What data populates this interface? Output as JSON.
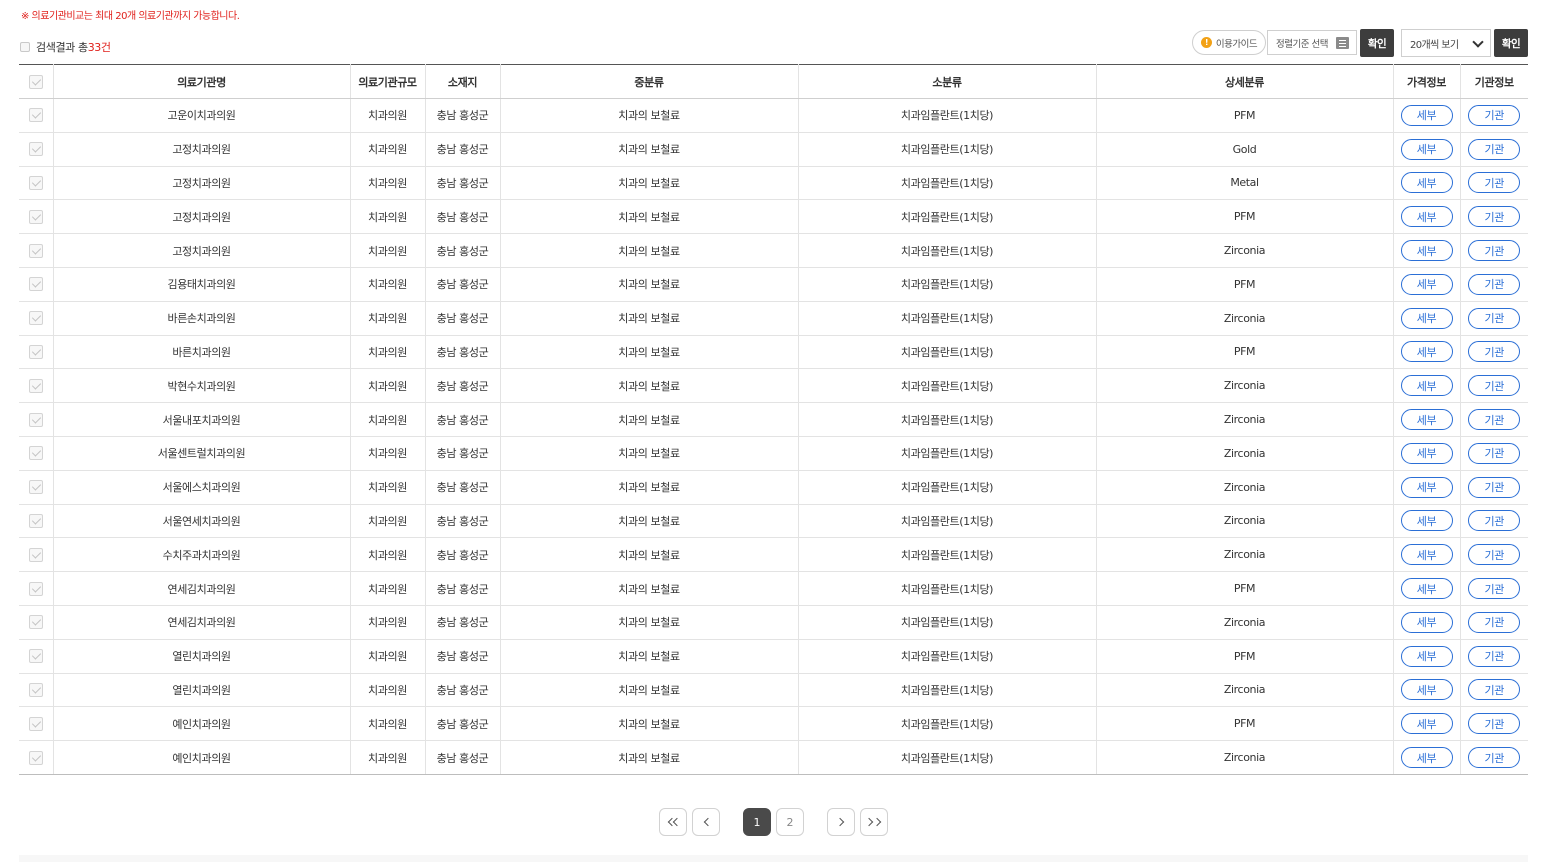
{
  "notice": "※ 의료기관비교는 최대 20개 의료기관까지 가능합니다.",
  "result": {
    "prefix": "검색결과 총",
    "count": "33건"
  },
  "toolbar": {
    "guide_label": "이용가이드",
    "sort_placeholder": "정렬기준 선택",
    "confirm_label": "확인",
    "view_label": "20개씩 보기",
    "confirm2_label": "확인"
  },
  "table": {
    "headers": [
      "의료기관명",
      "의료기관규모",
      "소재지",
      "중분류",
      "소분류",
      "상세분류",
      "가격정보",
      "기관정보"
    ],
    "price_button": "세부",
    "org_button": "기관",
    "rows": [
      [
        "고운이치과의원",
        "치과의원",
        "충남 홍성군",
        "치과의 보철료",
        "치과임플란트(1치당)",
        "PFM"
      ],
      [
        "고정치과의원",
        "치과의원",
        "충남 홍성군",
        "치과의 보철료",
        "치과임플란트(1치당)",
        "Gold"
      ],
      [
        "고정치과의원",
        "치과의원",
        "충남 홍성군",
        "치과의 보철료",
        "치과임플란트(1치당)",
        "Metal"
      ],
      [
        "고정치과의원",
        "치과의원",
        "충남 홍성군",
        "치과의 보철료",
        "치과임플란트(1치당)",
        "PFM"
      ],
      [
        "고정치과의원",
        "치과의원",
        "충남 홍성군",
        "치과의 보철료",
        "치과임플란트(1치당)",
        "Zirconia"
      ],
      [
        "김용태치과의원",
        "치과의원",
        "충남 홍성군",
        "치과의 보철료",
        "치과임플란트(1치당)",
        "PFM"
      ],
      [
        "바른손치과의원",
        "치과의원",
        "충남 홍성군",
        "치과의 보철료",
        "치과임플란트(1치당)",
        "Zirconia"
      ],
      [
        "바른치과의원",
        "치과의원",
        "충남 홍성군",
        "치과의 보철료",
        "치과임플란트(1치당)",
        "PFM"
      ],
      [
        "박현수치과의원",
        "치과의원",
        "충남 홍성군",
        "치과의 보철료",
        "치과임플란트(1치당)",
        "Zirconia"
      ],
      [
        "서울내포치과의원",
        "치과의원",
        "충남 홍성군",
        "치과의 보철료",
        "치과임플란트(1치당)",
        "Zirconia"
      ],
      [
        "서울센트럴치과의원",
        "치과의원",
        "충남 홍성군",
        "치과의 보철료",
        "치과임플란트(1치당)",
        "Zirconia"
      ],
      [
        "서울에스치과의원",
        "치과의원",
        "충남 홍성군",
        "치과의 보철료",
        "치과임플란트(1치당)",
        "Zirconia"
      ],
      [
        "서울연세치과의원",
        "치과의원",
        "충남 홍성군",
        "치과의 보철료",
        "치과임플란트(1치당)",
        "Zirconia"
      ],
      [
        "수치주과치과의원",
        "치과의원",
        "충남 홍성군",
        "치과의 보철료",
        "치과임플란트(1치당)",
        "Zirconia"
      ],
      [
        "연세김치과의원",
        "치과의원",
        "충남 홍성군",
        "치과의 보철료",
        "치과임플란트(1치당)",
        "PFM"
      ],
      [
        "연세김치과의원",
        "치과의원",
        "충남 홍성군",
        "치과의 보철료",
        "치과임플란트(1치당)",
        "Zirconia"
      ],
      [
        "열린치과의원",
        "치과의원",
        "충남 홍성군",
        "치과의 보철료",
        "치과임플란트(1치당)",
        "PFM"
      ],
      [
        "열린치과의원",
        "치과의원",
        "충남 홍성군",
        "치과의 보철료",
        "치과임플란트(1치당)",
        "Zirconia"
      ],
      [
        "예인치과의원",
        "치과의원",
        "충남 홍성군",
        "치과의 보철료",
        "치과임플란트(1치당)",
        "PFM"
      ],
      [
        "예인치과의원",
        "치과의원",
        "충남 홍성군",
        "치과의 보철료",
        "치과임플란트(1치당)",
        "Zirconia"
      ]
    ]
  },
  "pagination": {
    "pages": [
      "1",
      "2"
    ],
    "current": "1"
  },
  "colors": {
    "accent_red": "#e0201b",
    "button_blue": "#2b6fd6",
    "dark_button": "#3d3d3d"
  }
}
